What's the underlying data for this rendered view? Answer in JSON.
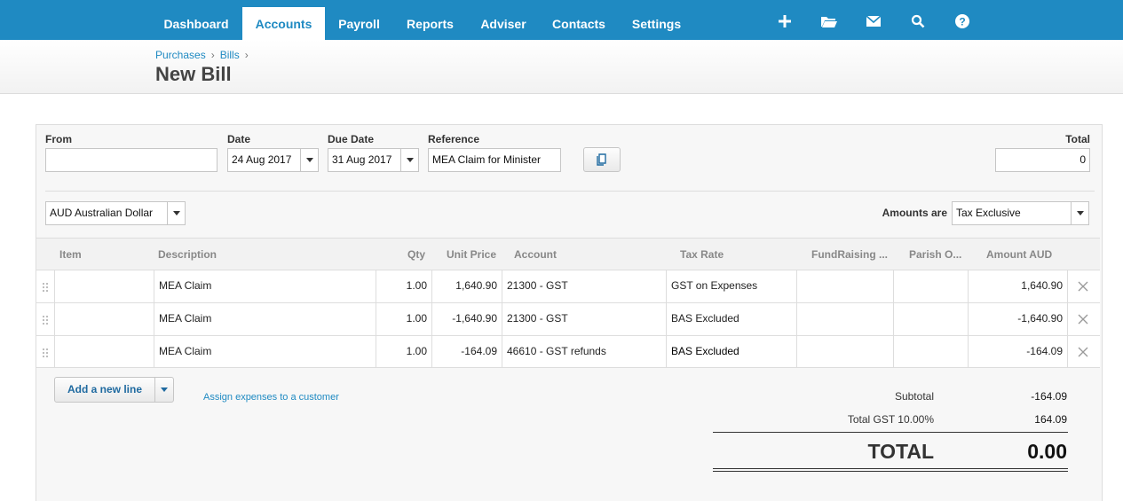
{
  "nav": {
    "tabs": [
      {
        "label": "Dashboard"
      },
      {
        "label": "Accounts"
      },
      {
        "label": "Payroll"
      },
      {
        "label": "Reports"
      },
      {
        "label": "Adviser"
      },
      {
        "label": "Contacts"
      },
      {
        "label": "Settings"
      }
    ],
    "active_tab": "Accounts",
    "icons": [
      "plus-icon",
      "folder-icon",
      "mail-icon",
      "search-icon",
      "help-icon"
    ]
  },
  "breadcrumb": [
    "Purchases",
    "Bills"
  ],
  "page_title": "New Bill",
  "form": {
    "from_label": "From",
    "from_value": "",
    "date_label": "Date",
    "date_value": "24 Aug 2017",
    "due_label": "Due Date",
    "due_value": "31 Aug 2017",
    "reference_label": "Reference",
    "reference_value": "MEA Claim for Minister",
    "total_label": "Total",
    "total_value": "0",
    "currency_value": "AUD Australian Dollar",
    "amounts_are_label": "Amounts are",
    "amounts_are_value": "Tax Exclusive"
  },
  "table": {
    "headers": {
      "item": "Item",
      "description": "Description",
      "qty": "Qty",
      "unit_price": "Unit Price",
      "account": "Account",
      "tax_rate": "Tax Rate",
      "fundraising": "FundRaising ...",
      "parish": "Parish O...",
      "amount": "Amount AUD"
    },
    "rows": [
      {
        "item": "",
        "description": "MEA Claim",
        "qty": "1.00",
        "unit_price": "1,640.90",
        "account": "21300 - GST",
        "tax_rate": "GST on Expenses",
        "fundraising": "",
        "parish": "",
        "amount": "1,640.90"
      },
      {
        "item": "",
        "description": "MEA Claim",
        "qty": "1.00",
        "unit_price": "-1,640.90",
        "account": "21300 - GST",
        "tax_rate": "BAS Excluded",
        "fundraising": "",
        "parish": "",
        "amount": "-1,640.90"
      },
      {
        "item": "",
        "description": "MEA Claim",
        "qty": "1.00",
        "unit_price": "-164.09",
        "account": "46610 - GST refunds",
        "tax_rate": "BAS Excluded",
        "fundraising": "",
        "parish": "",
        "amount": "-164.09"
      }
    ]
  },
  "actions": {
    "add_line_label": "Add a new line",
    "assign_link": "Assign expenses to a customer"
  },
  "totals": {
    "subtotal_label": "Subtotal",
    "subtotal_value": "-164.09",
    "gst_label": "Total GST 10.00%",
    "gst_value": "164.09",
    "total_label": "TOTAL",
    "total_value": "0.00"
  },
  "colors": {
    "nav_bg": "#1f8ac2",
    "link": "#1f8ac2"
  }
}
